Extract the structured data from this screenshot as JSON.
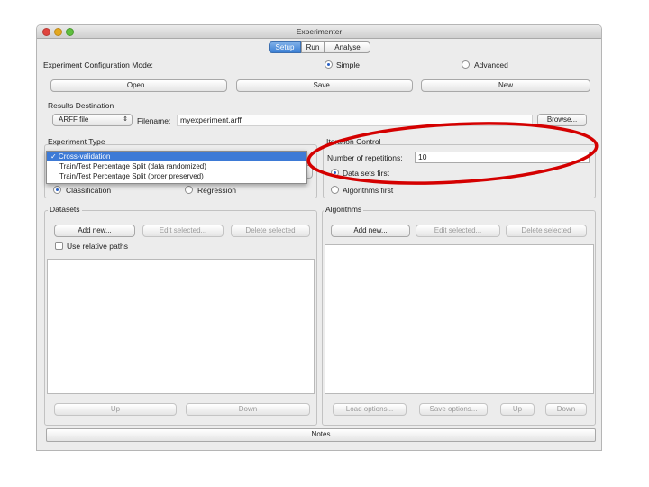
{
  "window": {
    "title": "Experimenter"
  },
  "tabs": [
    {
      "label": "Setup"
    },
    {
      "label": "Run"
    },
    {
      "label": "Analyse"
    }
  ],
  "config": {
    "mode_label": "Experiment Configuration Mode:",
    "simple_label": "Simple",
    "advanced_label": "Advanced",
    "open_label": "Open...",
    "save_label": "Save...",
    "new_label": "New"
  },
  "results": {
    "title": "Results Destination",
    "dest_type": "ARFF file",
    "filename_label": "Filename:",
    "filename_value": "myexperiment.arff",
    "browse_label": "Browse..."
  },
  "experiment_type": {
    "title": "Experiment Type",
    "options": [
      "✓ Cross-validation",
      "Train/Test Percentage Split (data randomized)",
      "Train/Test Percentage Split (order preserved)"
    ],
    "classification_label": "Classification",
    "regression_label": "Regression"
  },
  "iteration": {
    "title": "Iteration Control",
    "reps_label": "Number of repetitions:",
    "reps_value": "10",
    "datasets_first": "Data sets first",
    "algorithms_first": "Algorithms first"
  },
  "datasets": {
    "title": "Datasets",
    "add_new": "Add new...",
    "edit_selected": "Edit selected...",
    "delete_selected": "Delete selected",
    "use_relative_paths": "Use relative paths",
    "up": "Up",
    "down": "Down"
  },
  "algorithms": {
    "title": "Algorithms",
    "add_new": "Add new...",
    "edit_selected": "Edit selected...",
    "delete_selected": "Delete selected",
    "load_options": "Load options...",
    "save_options": "Save options...",
    "up": "Up",
    "down": "Down"
  },
  "notes": {
    "label": "Notes"
  },
  "colors": {
    "highlight": "#3d7ad6",
    "annotation_ellipse": "#d40000"
  }
}
